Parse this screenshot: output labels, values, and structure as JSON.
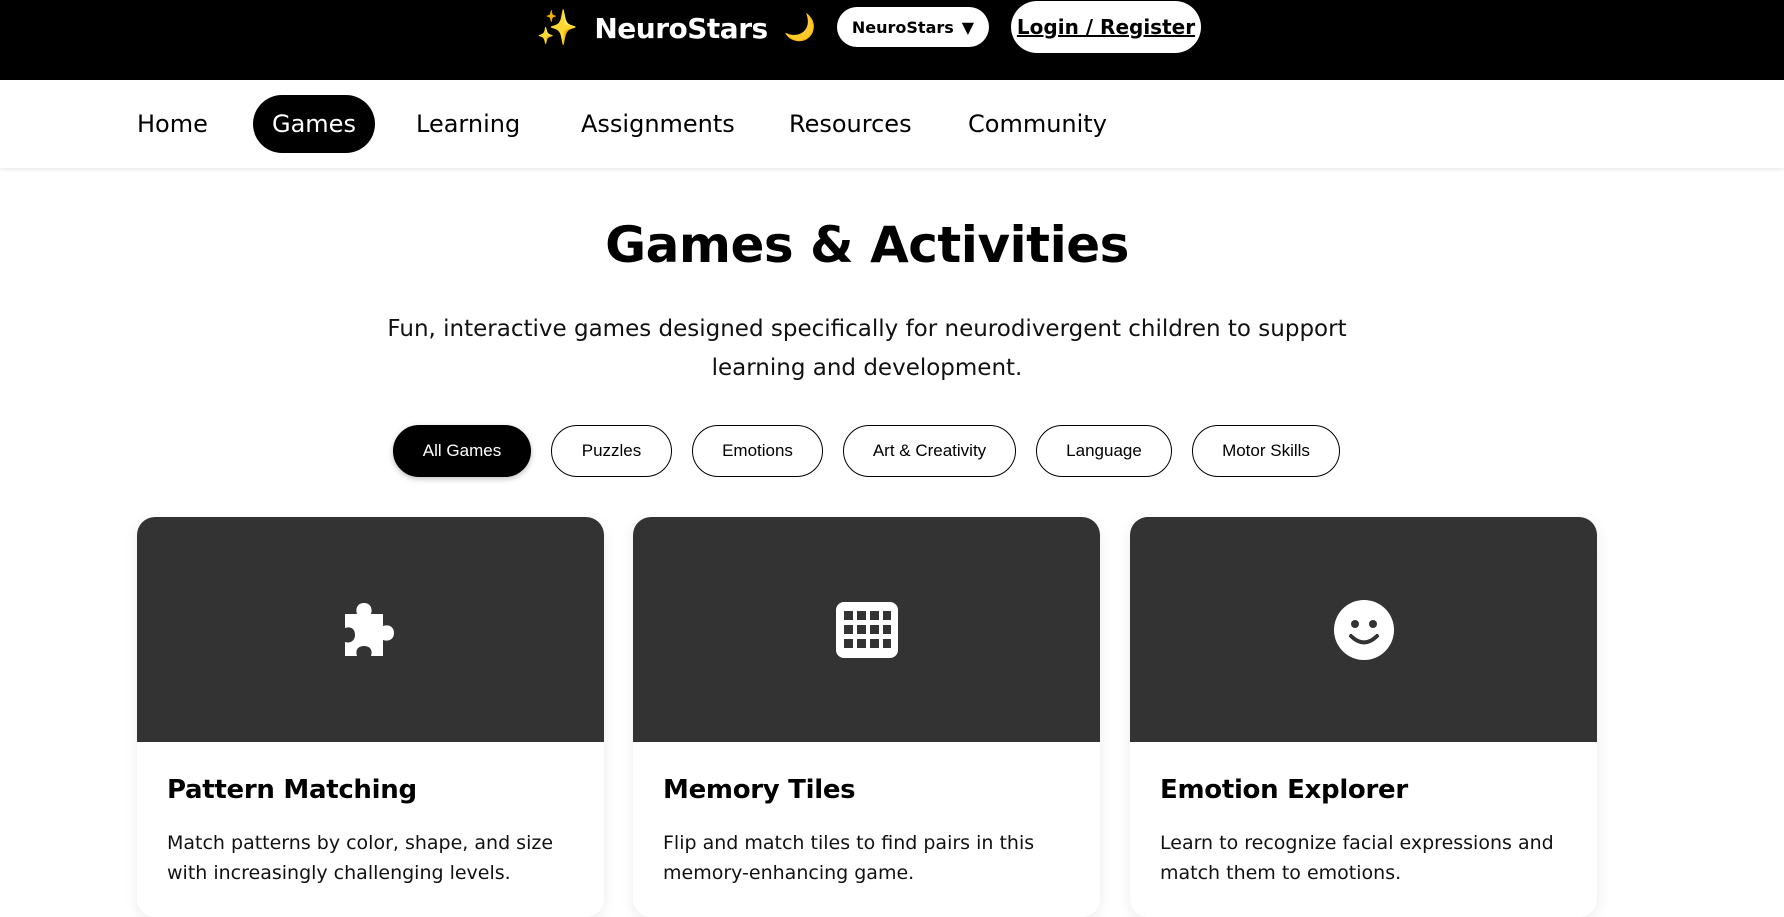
{
  "header": {
    "brand_name": "NeuroStars",
    "brand_icon_left": "✨",
    "brand_icon_right": "🌙",
    "site_select_value": "NeuroStars",
    "site_select_chevron": "▼",
    "login_label": "Login / Register"
  },
  "nav": {
    "items": [
      {
        "label": "Home"
      },
      {
        "label": "Games",
        "active": true
      },
      {
        "label": "Learning"
      },
      {
        "label": "Assignments"
      },
      {
        "label": "Resources"
      },
      {
        "label": "Community"
      }
    ]
  },
  "main": {
    "title": "Games & Activities",
    "subtitle": "Fun, interactive games designed specifically for neurodivergent children to support learning and development.",
    "filters": [
      {
        "label": "All Games",
        "active": true
      },
      {
        "label": "Puzzles"
      },
      {
        "label": "Emotions"
      },
      {
        "label": "Art & Creativity"
      },
      {
        "label": "Language"
      },
      {
        "label": "Motor Skills"
      }
    ],
    "cards": [
      {
        "icon": "puzzle-icon",
        "title": "Pattern Matching",
        "description": "Match patterns by color, shape, and size with increasingly challenging levels."
      },
      {
        "icon": "grid-icon",
        "title": "Memory Tiles",
        "description": "Flip and match tiles to find pairs in this memory-enhancing game."
      },
      {
        "icon": "smiley-icon",
        "title": "Emotion Explorer",
        "description": "Learn to recognize facial expressions and match them to emotions."
      }
    ]
  },
  "colors": {
    "topbar": "#000000",
    "card_banner": "#333333",
    "active_pill": "#000000"
  }
}
